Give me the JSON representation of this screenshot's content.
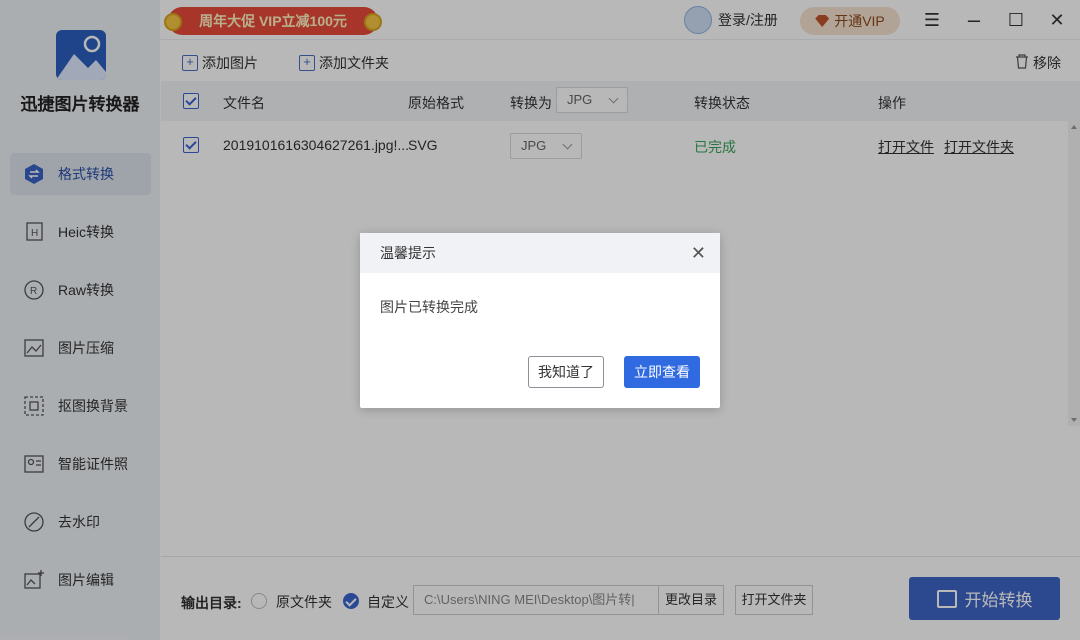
{
  "app": {
    "name": "迅捷图片转换器"
  },
  "sidebar": {
    "items": [
      {
        "label": "格式转换",
        "icon": "swap-icon",
        "active": true
      },
      {
        "label": "Heic转换",
        "icon": "heic-icon",
        "active": false
      },
      {
        "label": "Raw转换",
        "icon": "raw-icon",
        "active": false
      },
      {
        "label": "图片压缩",
        "icon": "compress-icon",
        "active": false
      },
      {
        "label": "抠图换背景",
        "icon": "cutout-icon",
        "active": false
      },
      {
        "label": "智能证件照",
        "icon": "id-photo-icon",
        "active": false
      },
      {
        "label": "去水印",
        "icon": "watermark-icon",
        "active": false
      },
      {
        "label": "图片编辑",
        "icon": "edit-image-icon",
        "active": false
      }
    ]
  },
  "topbar": {
    "promo": "周年大促 VIP立减100元",
    "login": "登录/注册",
    "vip": "开通VIP"
  },
  "toolbar": {
    "add_image": "添加图片",
    "add_folder": "添加文件夹",
    "remove": "移除"
  },
  "table": {
    "headers": {
      "filename": "文件名",
      "orig_format": "原始格式",
      "convert_to": "转换为",
      "convert_to_value": "JPG",
      "status": "转换状态",
      "actions": "操作"
    },
    "rows": [
      {
        "filename": "2019101616304627261.jpg!...",
        "orig_format": "SVG",
        "target_format": "JPG",
        "status": "已完成",
        "open_file": "打开文件",
        "open_folder": "打开文件夹"
      }
    ]
  },
  "modal": {
    "title": "温馨提示",
    "message": "图片已转换完成",
    "secondary": "我知道了",
    "primary": "立即查看"
  },
  "footer": {
    "label": "输出目录:",
    "option_original": "原文件夹",
    "option_custom": "自定义",
    "path": "C:\\Users\\NING MEI\\Desktop\\图片转|",
    "change_dir": "更改目录",
    "open_folder": "打开文件夹",
    "start": "开始转换"
  },
  "colors": {
    "accent": "#2f6ae0",
    "success": "#3aa35a",
    "sidebar_bg": "#eef1f6",
    "promo": "#e94a3a"
  }
}
